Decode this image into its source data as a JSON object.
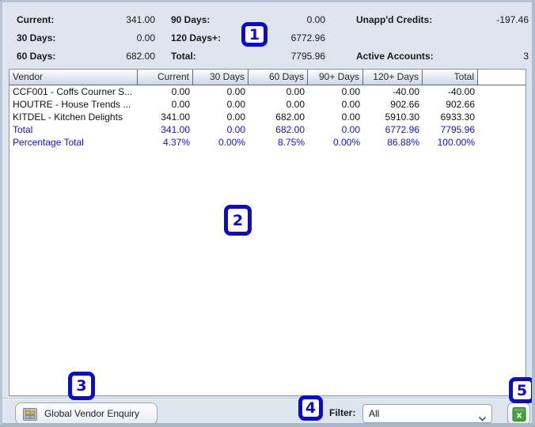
{
  "summary": {
    "rows": [
      [
        {
          "label": "Current:",
          "value": "341.00"
        },
        {
          "label": "90 Days:",
          "value": "0.00"
        },
        {
          "label": "Unapp'd Credits:",
          "value": "-197.46"
        }
      ],
      [
        {
          "label": "30 Days:",
          "value": "0.00"
        },
        {
          "label": "120 Days+:",
          "value": "6772.96"
        },
        {
          "label": "",
          "value": ""
        }
      ],
      [
        {
          "label": "60 Days:",
          "value": "682.00"
        },
        {
          "label": "Total:",
          "value": "7795.96"
        },
        {
          "label": "Active Accounts:",
          "value": "3"
        }
      ]
    ]
  },
  "table": {
    "columns": [
      "Vendor",
      "Current",
      "30 Days",
      "60 Days",
      "90+ Days",
      "120+ Days",
      "Total"
    ],
    "rows": [
      {
        "cells": [
          "CCF001 - Coffs Courner S...",
          "0.00",
          "0.00",
          "0.00",
          "0.00",
          "-40.00",
          "-40.00"
        ],
        "style": "normal"
      },
      {
        "cells": [
          "HOUTRE - House Trends ...",
          "0.00",
          "0.00",
          "0.00",
          "0.00",
          "902.66",
          "902.66"
        ],
        "style": "normal"
      },
      {
        "cells": [
          "KITDEL - Kitchen Delights",
          "341.00",
          "0.00",
          "682.00",
          "0.00",
          "5910.30",
          "6933.30"
        ],
        "style": "normal"
      },
      {
        "cells": [
          "Total",
          "341.00",
          "0.00",
          "682.00",
          "0.00",
          "6772.96",
          "7795.96"
        ],
        "style": "total"
      },
      {
        "cells": [
          "Percentage Total",
          "4.37%",
          "0.00%",
          "8.75%",
          "0.00%",
          "86.88%",
          "100.00%"
        ],
        "style": "total"
      }
    ]
  },
  "footer": {
    "enquiry_button": "Global Vendor Enquiry",
    "enquiry_icon": "archive-drawer-icon",
    "filter_label": "Filter:",
    "filter_value": "All",
    "export_icon": "excel-export-icon"
  },
  "annotations": [
    "1",
    "2",
    "3",
    "4",
    "5"
  ],
  "colors": {
    "annotation_blue": "#0b0bd2",
    "total_row_blue": "#1414d2",
    "panel_background": "#dfe5ee",
    "excel_green": "#43a23e"
  }
}
